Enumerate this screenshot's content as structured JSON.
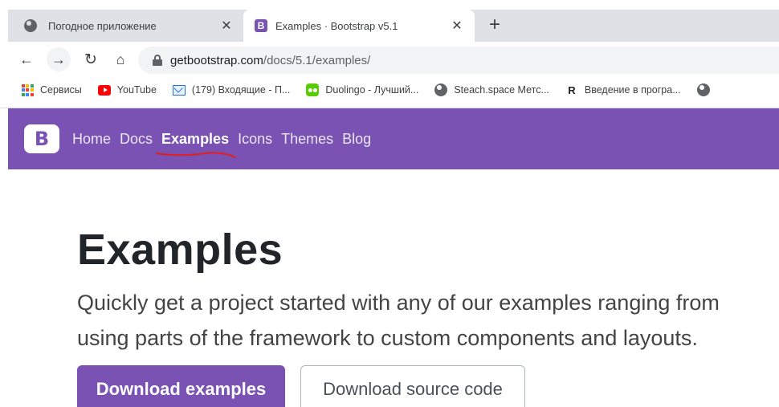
{
  "browser": {
    "tabs": [
      {
        "title": "Погодное приложение",
        "close": "✕"
      },
      {
        "title": "Examples · Bootstrap v5.1",
        "close": "✕",
        "favicon_letter": "B"
      }
    ],
    "new_tab": "+",
    "nav": {
      "back": "←",
      "forward": "→",
      "reload": "↻",
      "home": "⌂"
    },
    "url": {
      "host": "getbootstrap.com",
      "path": "/docs/5.1/examples/"
    },
    "bookmarks": [
      {
        "label": "Сервисы",
        "icon": "apps-grid-icon"
      },
      {
        "label": "YouTube",
        "icon": "youtube-icon"
      },
      {
        "label": "(179) Входящие - П...",
        "icon": "mail-icon"
      },
      {
        "label": "Duolingo - Лучший...",
        "icon": "duolingo-icon"
      },
      {
        "label": "Steach.space Метс...",
        "icon": "globe-icon"
      },
      {
        "label": "Введение в програ...",
        "icon": "r-logo-icon",
        "icon_letter": "R"
      }
    ]
  },
  "site": {
    "logo_letter": "B",
    "nav": [
      "Home",
      "Docs",
      "Examples",
      "Icons",
      "Themes",
      "Blog"
    ],
    "active_nav": "Examples",
    "brand_color": "#7952b3"
  },
  "hero": {
    "title": "Examples",
    "lead": "Quickly get a project started with any of our examples ranging from using parts of the framework to custom components and layouts.",
    "primary_button": "Download examples",
    "secondary_button": "Download source code"
  }
}
